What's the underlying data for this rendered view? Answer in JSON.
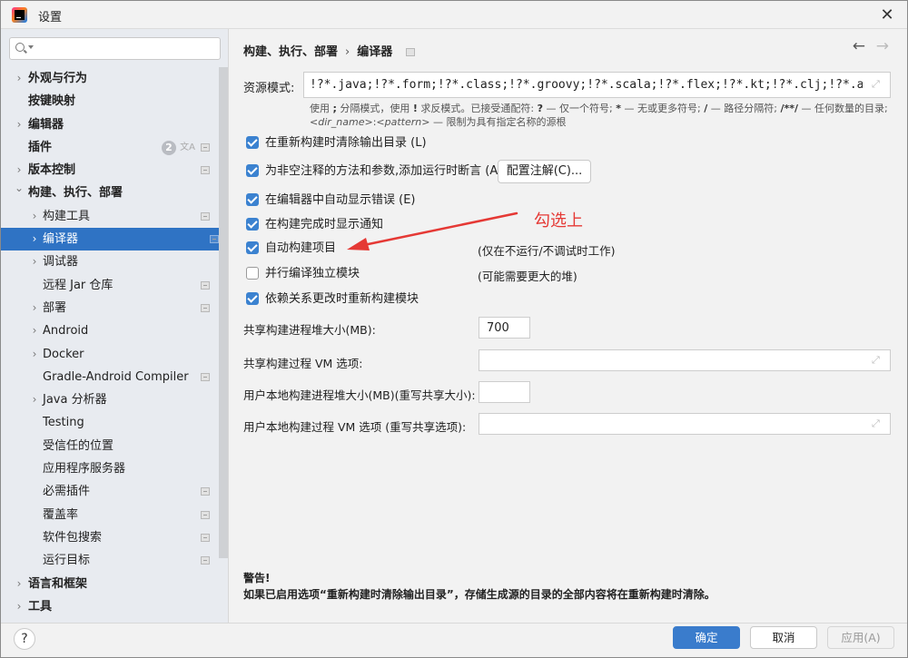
{
  "window": {
    "title": "设置",
    "close_icon": "close-icon"
  },
  "sidebar": {
    "search_placeholder": "",
    "items": [
      {
        "label": "外观与行为",
        "level": 0,
        "chevron": "right",
        "project_icon": false
      },
      {
        "label": "按键映射",
        "level": 0,
        "chevron": "none",
        "project_icon": false
      },
      {
        "label": "编辑器",
        "level": 0,
        "chevron": "right",
        "project_icon": false
      },
      {
        "label": "插件",
        "level": 0,
        "chevron": "none",
        "project_icon": true,
        "badge": "2",
        "translate_icon": true
      },
      {
        "label": "版本控制",
        "level": 0,
        "chevron": "right",
        "project_icon": true
      },
      {
        "label": "构建、执行、部署",
        "level": 0,
        "chevron": "down",
        "project_icon": false
      },
      {
        "label": "构建工具",
        "level": 1,
        "chevron": "right",
        "project_icon": true
      },
      {
        "label": "编译器",
        "level": 1,
        "chevron": "right",
        "project_icon": true,
        "selected": true
      },
      {
        "label": "调试器",
        "level": 1,
        "chevron": "right",
        "project_icon": false
      },
      {
        "label": "远程 Jar 仓库",
        "level": 1,
        "chevron": "none",
        "project_icon": true
      },
      {
        "label": "部署",
        "level": 1,
        "chevron": "right",
        "project_icon": true
      },
      {
        "label": "Android",
        "level": 1,
        "chevron": "right",
        "project_icon": false
      },
      {
        "label": "Docker",
        "level": 1,
        "chevron": "right",
        "project_icon": false
      },
      {
        "label": "Gradle-Android Compiler",
        "level": 1,
        "chevron": "none",
        "project_icon": true
      },
      {
        "label": "Java 分析器",
        "level": 1,
        "chevron": "right",
        "project_icon": false
      },
      {
        "label": "Testing",
        "level": 1,
        "chevron": "none",
        "project_icon": false
      },
      {
        "label": "受信任的位置",
        "level": 1,
        "chevron": "none",
        "project_icon": false
      },
      {
        "label": "应用程序服务器",
        "level": 1,
        "chevron": "none",
        "project_icon": false
      },
      {
        "label": "必需插件",
        "level": 1,
        "chevron": "none",
        "project_icon": true
      },
      {
        "label": "覆盖率",
        "level": 1,
        "chevron": "none",
        "project_icon": true
      },
      {
        "label": "软件包搜索",
        "level": 1,
        "chevron": "none",
        "project_icon": true
      },
      {
        "label": "运行目标",
        "level": 1,
        "chevron": "none",
        "project_icon": true
      },
      {
        "label": "语言和框架",
        "level": 0,
        "chevron": "right",
        "project_icon": false
      },
      {
        "label": "工具",
        "level": 0,
        "chevron": "right",
        "project_icon": false
      }
    ]
  },
  "content": {
    "breadcrumb": [
      "构建、执行、部署",
      "编译器"
    ],
    "breadcrumb_sep": "›",
    "nav_back": "←",
    "nav_forward": "→",
    "resource_patterns": {
      "label": "资源模式:",
      "value": "!?*.java;!?*.form;!?*.class;!?*.groovy;!?*.scala;!?*.flex;!?*.kt;!?*.clj;!?*.aj",
      "hint_line1_parts": [
        "使用 ",
        ";",
        " 分隔模式，使用 ",
        "!",
        " 求反模式。已接受通配符: ",
        "?",
        " — 仅一个符号; ",
        "*",
        " — 无或更多符号; ",
        "/",
        " — 路径分隔符; ",
        "/**/",
        " — 任何数量的目录;"
      ],
      "hint_line2_dir": "<dir_name>",
      "hint_line2_colon": ":",
      "hint_line2_pattern": "<pattern>",
      "hint_line2_rest": " — 限制为具有指定名称的源根"
    },
    "checkboxes": [
      {
        "label": "在重新构建时清除输出目录 (L)",
        "checked": true
      },
      {
        "label": "为非空注释的方法和参数,添加运行时断言 (A)",
        "checked": true
      },
      {
        "label": "在编辑器中自动显示错误 (E)",
        "checked": true
      },
      {
        "label": "在构建完成时显示通知",
        "checked": true
      },
      {
        "label": "自动构建项目",
        "checked": true,
        "note": "(仅在不运行/不调试时工作)"
      },
      {
        "label": "并行编译独立模块",
        "checked": false,
        "note": "(可能需要更大的堆)"
      },
      {
        "label": "依赖关系更改时重新构建模块",
        "checked": true
      }
    ],
    "config_annotations_button": "配置注解(C)...",
    "fields": [
      {
        "label": "共享构建进程堆大小(MB):",
        "value": "700"
      },
      {
        "label": "共享构建过程 VM 选项:",
        "value": ""
      },
      {
        "label": "用户本地构建进程堆大小(MB)(重写共享大小):",
        "value": ""
      },
      {
        "label": "用户本地构建过程 VM 选项 (重写共享选项):",
        "value": ""
      }
    ],
    "annotation": {
      "text": "勾选上",
      "color": "#e53935"
    },
    "warning_title": "警告!",
    "warning_text": "如果已启用选项“重新构建时清除输出目录”，存储生成源的目录的全部内容将在重新构建时清除。"
  },
  "footer": {
    "help": "?",
    "ok": "确定",
    "cancel": "取消",
    "apply": "应用(A)"
  },
  "colors": {
    "accent": "#2f73c4",
    "checkbox": "#3b82d0",
    "ok_button": "#3a7ccc"
  }
}
